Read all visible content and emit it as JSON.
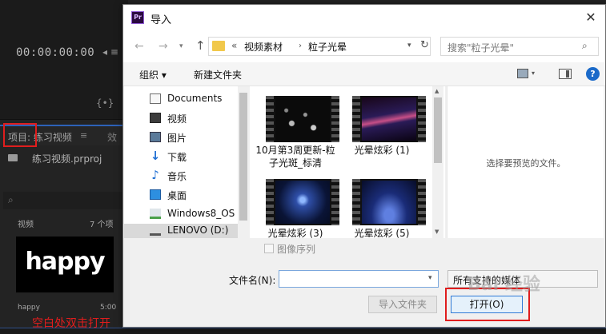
{
  "premiere": {
    "timecode": "00:00:00:00",
    "marker": "◂ ≡",
    "bracket": "{•}",
    "tab_project": "项目: 练习视频",
    "tab_menu": "≡",
    "tab_effects": "效",
    "project_file": "练习视频.prproj",
    "bin_label": "视频",
    "bin_count": "7 个项",
    "clip_thumb_text": "happy",
    "clip_name": "happy",
    "clip_duration": "5:00"
  },
  "annotation": "空白处双击打开",
  "dialog": {
    "app_icon": "Pr",
    "title": "导入",
    "close": "✕",
    "address": {
      "prefix": "«",
      "crumbs": [
        "视频素材",
        "粒子光晕"
      ],
      "separator": "›"
    },
    "search_placeholder": "搜索\"粒子光晕\"",
    "toolbar": {
      "organize": "组织 ▾",
      "new_folder": "新建文件夹",
      "help": "?"
    },
    "nav_items": [
      {
        "label": "Documents",
        "icon": "document-icon"
      },
      {
        "label": "视频",
        "icon": "video-icon"
      },
      {
        "label": "图片",
        "icon": "pictures-icon"
      },
      {
        "label": "下载",
        "icon": "download-icon"
      },
      {
        "label": "音乐",
        "icon": "music-icon"
      },
      {
        "label": "桌面",
        "icon": "desktop-icon"
      },
      {
        "label": "Windows8_OS",
        "icon": "windows-drive-icon"
      },
      {
        "label": "LENOVO (D:)",
        "icon": "drive-icon",
        "selected": true
      }
    ],
    "files": [
      {
        "label": "10月第3周更新-粒子光斑_标清"
      },
      {
        "label": "光晕炫彩 (1)"
      },
      {
        "label": "光晕炫彩 (3)"
      },
      {
        "label": "光晕炫彩 (5)"
      }
    ],
    "preview_text": "选择要预览的文件。",
    "image_sequence": "图像序列",
    "filename_label": "文件名(N):",
    "filename_value": "",
    "filetype": "所有支持的媒体",
    "import_folder": "导入文件夹",
    "open": "打开(O)"
  },
  "watermark": "Bai 经验"
}
